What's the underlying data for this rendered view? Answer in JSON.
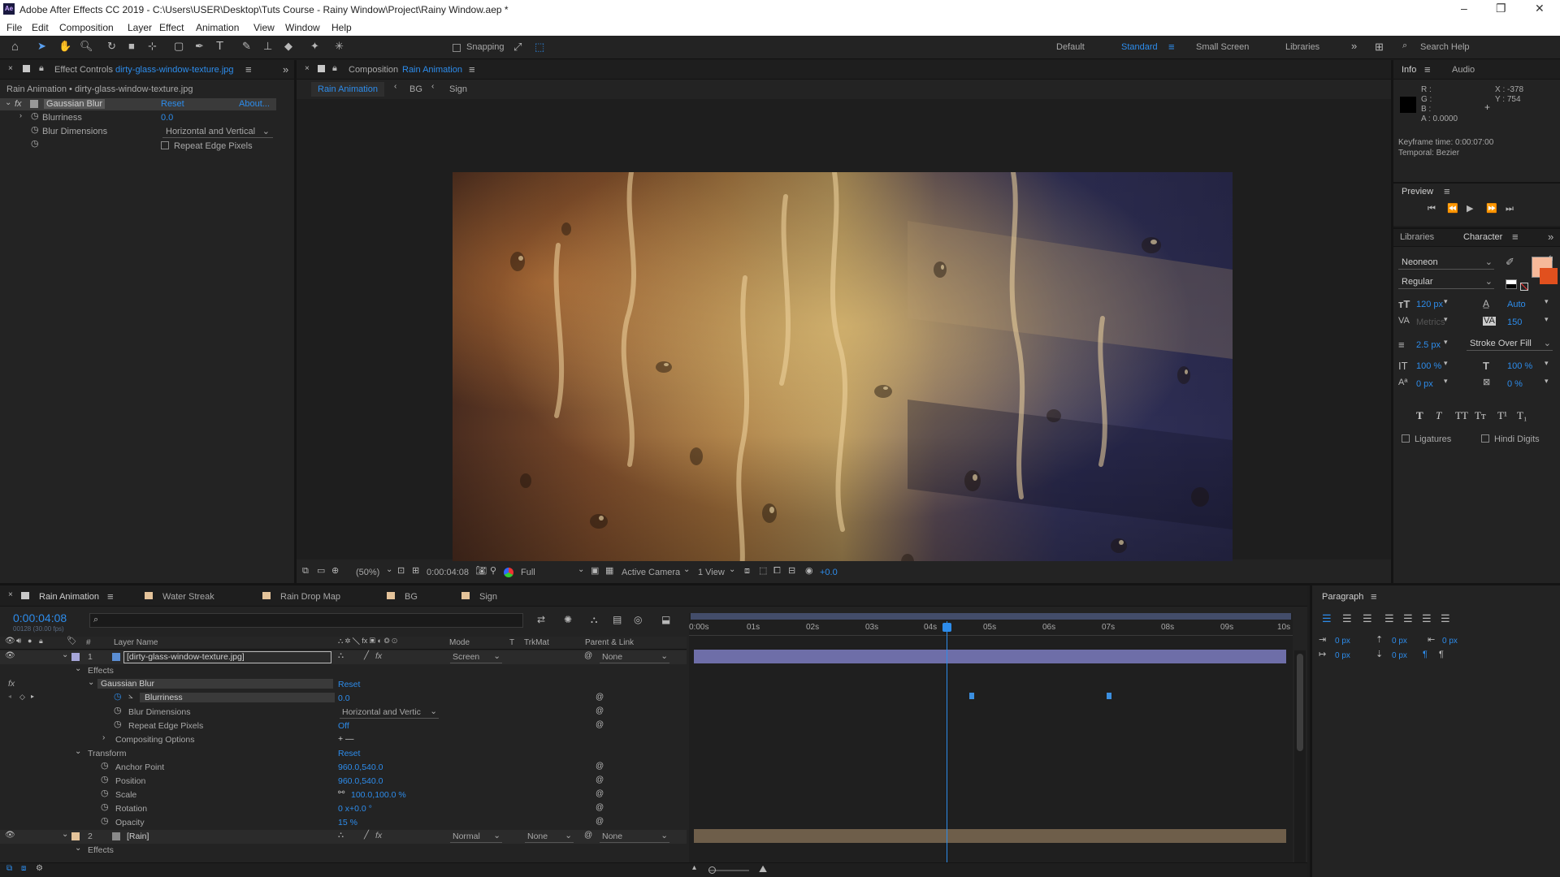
{
  "window": {
    "title": "Adobe After Effects CC 2019 - C:\\Users\\USER\\Desktop\\Tuts Course - Rainy Window\\Project\\Rainy Window.aep *",
    "logo": "Ae",
    "controls": [
      "–",
      "❐",
      "✕"
    ]
  },
  "menu": [
    "File",
    "Edit",
    "Composition",
    "Layer",
    "Effect",
    "Animation",
    "View",
    "Window",
    "Help"
  ],
  "toolbar": {
    "snapping_label": "Snapping",
    "workspaces": [
      "Default",
      "Standard",
      "Small Screen",
      "Libraries"
    ],
    "search_placeholder": "Search Help"
  },
  "effect_controls": {
    "tab_prefix": "Effect Controls",
    "tab_file": "dirty-glass-window-texture.jpg",
    "subtitle": "Rain Animation • dirty-glass-window-texture.jpg",
    "effect_name": "Gaussian Blur",
    "reset": "Reset",
    "about": "About...",
    "fx_badge": "fx",
    "props": [
      {
        "name": "Blurriness",
        "value": "0.0"
      },
      {
        "name": "Blur Dimensions",
        "value": "Horizontal and Vertical"
      },
      {
        "name": "Repeat Edge Pixels",
        "value": ""
      }
    ]
  },
  "composition": {
    "tab_prefix": "Composition",
    "tab_name": "Rain Animation",
    "breadcrumbs": [
      "Rain Animation",
      "BG",
      "Sign"
    ],
    "zoom": "(50%)",
    "timecode": "0:00:04:08",
    "resolution": "Full",
    "camera": "Active Camera",
    "view": "1 View",
    "exposure": "+0.0"
  },
  "info": {
    "tabs": [
      "Info",
      "Audio"
    ],
    "rgba": [
      "R :",
      "G :",
      "B :",
      "A : 0.0000"
    ],
    "x": "X : -378",
    "y": "Y : 754",
    "kf_time": "Keyframe time: 0:00:07:00",
    "temporal": "Temporal: Bezier"
  },
  "preview": {
    "title": "Preview"
  },
  "character": {
    "tabs": [
      "Libraries",
      "Character"
    ],
    "font": "Neoneon",
    "style": "Regular",
    "size": "120 px",
    "leading": "Auto",
    "kerning": "Metrics",
    "tracking": "150",
    "stroke_width": "2.5 px",
    "stroke_mode": "Stroke Over Fill",
    "vscale": "100 %",
    "hscale": "100 %",
    "baseline": "0 px",
    "tsume": "0 %",
    "styles": [
      "T",
      "T",
      "TT",
      "Tт",
      "T¹",
      "T₁"
    ],
    "ligatures": "Ligatures",
    "hindi_digits": "Hindi Digits",
    "fill_color": "#f6b99a",
    "stroke_color": "#e1501e"
  },
  "paragraph": {
    "title": "Paragraph",
    "fields": [
      "0 px",
      "0 px",
      "0 px",
      "0 px",
      "0 px"
    ]
  },
  "timeline": {
    "tabs": [
      "Rain Animation",
      "Water Streak",
      "Rain Drop Map",
      "BG",
      "Sign"
    ],
    "timecode": "0:00:04:08",
    "fps": "00128 (30.00 fps)",
    "columns": {
      "layer_name": "Layer Name",
      "mode": "Mode",
      "t": "T",
      "trkmat": "TrkMat",
      "parent": "Parent & Link",
      "num": "#"
    },
    "ruler": [
      "0:00s",
      "01s",
      "02s",
      "03s",
      "04s",
      "05s",
      "06s",
      "07s",
      "08s",
      "09s",
      "10s"
    ],
    "layer1": {
      "num": "1",
      "name": "[dirty-glass-window-texture.jpg]",
      "mode": "Screen",
      "parent": "None"
    },
    "layer2": {
      "num": "2",
      "name": "[Rain]",
      "mode": "Normal",
      "trkmat": "None",
      "parent": "None"
    },
    "tree": {
      "effects": "Effects",
      "gaussian": "Gaussian Blur",
      "gaussian_reset": "Reset",
      "blurriness": "Blurriness",
      "blurriness_val": "0.0",
      "blur_dim": "Blur Dimensions",
      "blur_dim_val": "Horizontal and Vertic",
      "repeat": "Repeat Edge Pixels",
      "repeat_val": "Off",
      "compositing": "Compositing Options",
      "compositing_val": "+ —",
      "transform": "Transform",
      "transform_reset": "Reset",
      "anchor": "Anchor Point",
      "anchor_val": "960.0,540.0",
      "position": "Position",
      "position_val": "960.0,540.0",
      "scale": "Scale",
      "scale_val": "100.0,100.0 %",
      "rotation": "Rotation",
      "rotation_val": "0 x+0.0 °",
      "opacity": "Opacity",
      "opacity_val": "15 %",
      "effects2": "Effects"
    }
  }
}
